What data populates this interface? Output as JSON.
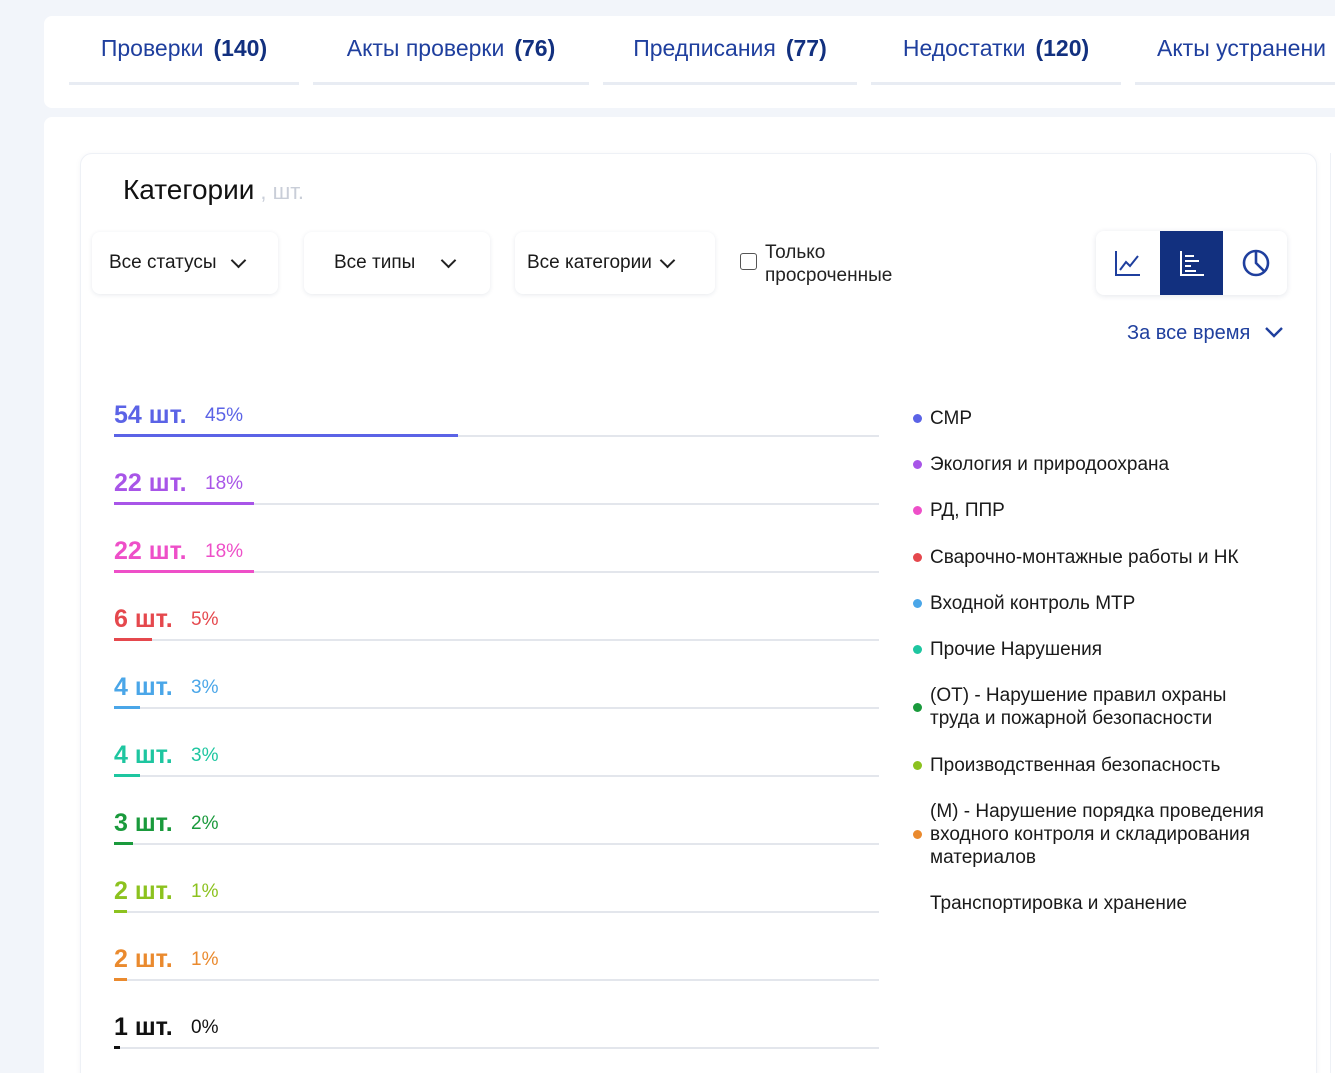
{
  "tabs": [
    {
      "label": "Проверки",
      "count": "(140)"
    },
    {
      "label": "Акты проверки",
      "count": "(76)"
    },
    {
      "label": "Предписания",
      "count": "(77)"
    },
    {
      "label": "Недостатки",
      "count": "(120)"
    },
    {
      "label": "Акты устранени",
      "count": ""
    }
  ],
  "panel": {
    "title": "Категории",
    "title_unit": ", шт."
  },
  "filters": {
    "status": "Все статусы",
    "types": "Все типы",
    "categories": "Все категории",
    "overdue_line1": "Только",
    "overdue_line2": "просроченные"
  },
  "view_toggle": {
    "icons": [
      "line-chart-icon",
      "bar-chart-icon",
      "pie-chart-icon"
    ],
    "active": "bar-chart-icon",
    "active_color": "#12307f"
  },
  "period": "За все время",
  "chart_data": {
    "type": "bar",
    "orientation": "horizontal",
    "unit": "шт.",
    "categories": [
      "СМР",
      "Экология и природоохрана",
      "РД, ППР",
      "Сварочно-монтажные работы и НК",
      "Входной контроль МТР",
      "Прочие Нарушения",
      "(ОТ) - Нарушение правил охраны труда и пожарной безопасности",
      "Производственная безопасность",
      "(М) - Нарушение порядка проведения входного контроля и складирования материалов",
      "Транспортировка и хранение"
    ],
    "values": [
      54,
      22,
      22,
      6,
      4,
      4,
      3,
      2,
      2,
      1
    ],
    "percents": [
      "45%",
      "18%",
      "18%",
      "5%",
      "3%",
      "3%",
      "2%",
      "1%",
      "1%",
      "0%"
    ],
    "count_labels": [
      "54 шт.",
      "22 шт.",
      "22 шт.",
      "6 шт.",
      "4 шт.",
      "4 шт.",
      "3 шт.",
      "2 шт.",
      "2 шт.",
      "1 шт."
    ],
    "colors": [
      "#5b63e6",
      "#a855e8",
      "#ee4fc8",
      "#e5484d",
      "#4aa6e8",
      "#1ec6a0",
      "#1a9a3c",
      "#8cc21f",
      "#ea8a2e",
      "#111111"
    ],
    "legend_dot_visible": [
      true,
      true,
      true,
      true,
      true,
      true,
      true,
      true,
      true,
      false
    ],
    "xlim": [
      0,
      120
    ],
    "legend_position": "right"
  }
}
